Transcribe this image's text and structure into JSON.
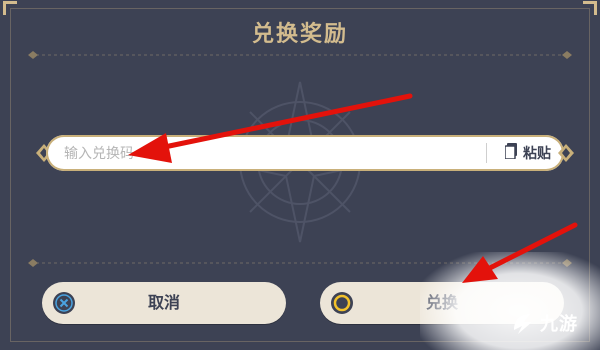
{
  "dialog": {
    "title": "兑换奖励"
  },
  "code_input": {
    "placeholder": "输入兑换码",
    "paste_label": "粘贴",
    "paste_icon": "clipboard-icon"
  },
  "buttons": {
    "cancel_label": "取消",
    "cancel_icon": "cross-circle-icon",
    "confirm_label": "兑换",
    "confirm_icon": "circle-icon"
  },
  "watermark_logo": {
    "text": "九游"
  },
  "colors": {
    "panel": "#3d4254",
    "accent_gold": "#d3bc8e",
    "button_bg": "#ece5d8",
    "arrow": "#e3120b"
  }
}
